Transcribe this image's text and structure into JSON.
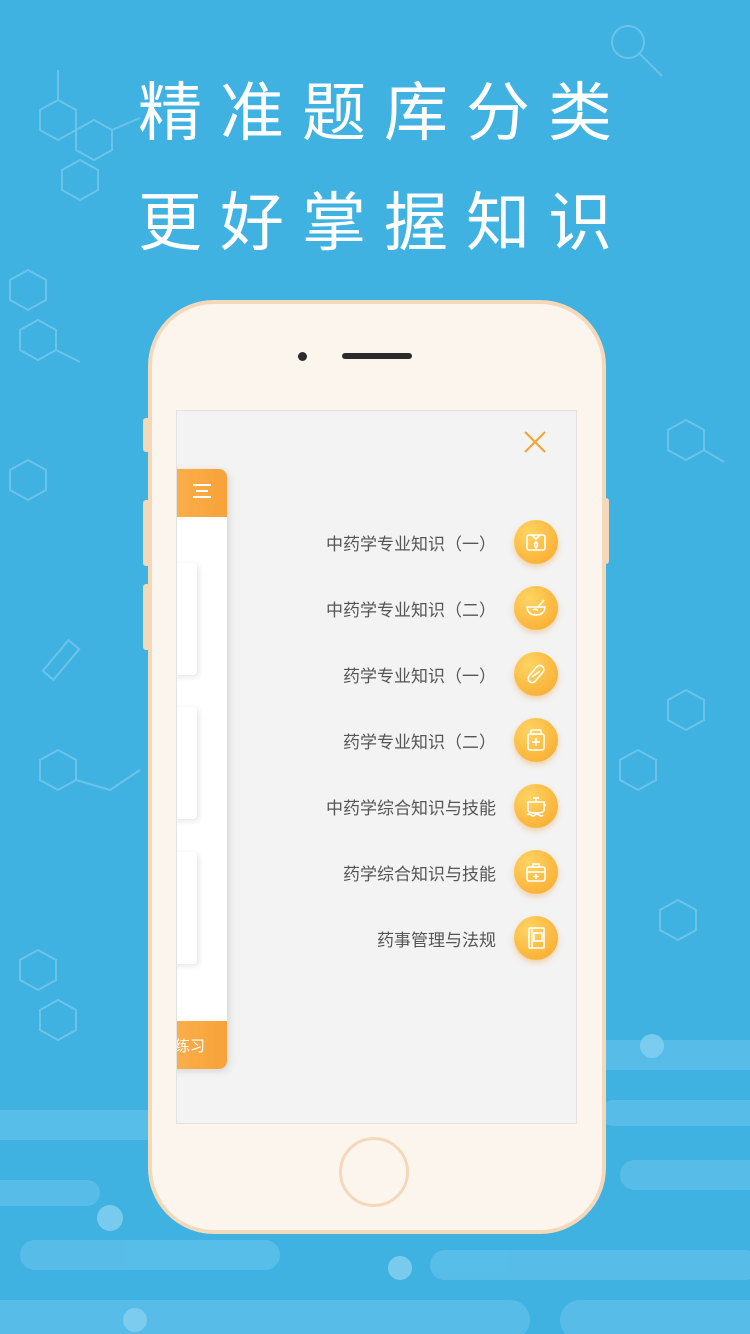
{
  "headline": {
    "line1": "精准题库分类",
    "line2": "更好掌握知识"
  },
  "left_panel": {
    "bottom_label": "练习"
  },
  "subjects": [
    {
      "label": "中药学专业知识（一）",
      "icon": "herb-box-icon"
    },
    {
      "label": "中药学专业知识（二）",
      "icon": "mortar-bowl-icon"
    },
    {
      "label": "药学专业知识（一）",
      "icon": "capsule-icon"
    },
    {
      "label": "药学专业知识（二）",
      "icon": "medicine-bottle-icon"
    },
    {
      "label": "中药学综合知识与技能",
      "icon": "decoction-pot-icon"
    },
    {
      "label": "药学综合知识与技能",
      "icon": "first-aid-kit-icon"
    },
    {
      "label": "药事管理与法规",
      "icon": "law-book-icon"
    }
  ],
  "colors": {
    "background": "#3fb2e2",
    "accent": "#fbb43a",
    "phone_frame": "#f3d9b9",
    "close_icon": "#f5a530"
  }
}
